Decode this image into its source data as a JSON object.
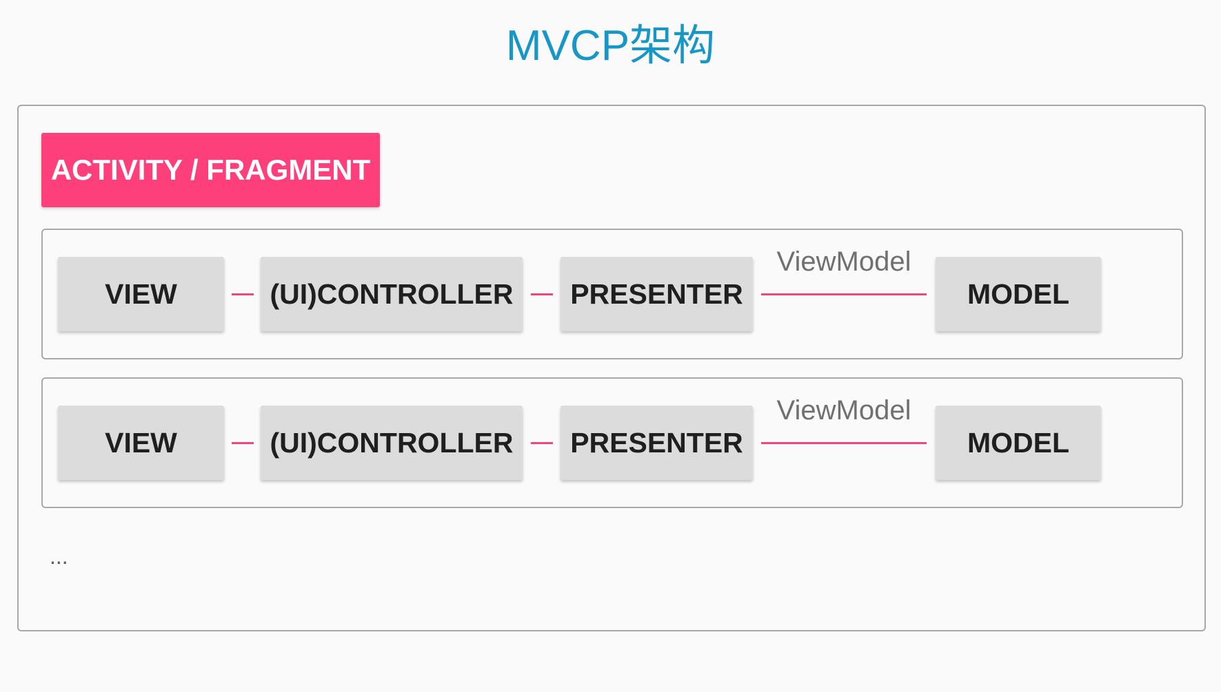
{
  "title": "MVCP架构",
  "container": {
    "tag_label": "ACTIVITY / FRAGMENT",
    "rows": [
      {
        "view": "VIEW",
        "controller": "(UI)CONTROLLER",
        "presenter": "PRESENTER",
        "link_label": "ViewModel",
        "model": "MODEL"
      },
      {
        "view": "VIEW",
        "controller": "(UI)CONTROLLER",
        "presenter": "PRESENTER",
        "link_label": "ViewModel",
        "model": "MODEL"
      }
    ],
    "more": "..."
  },
  "colors": {
    "title": "#1796c8",
    "tag_background": "#fd3f7c",
    "connector": "#f0457f",
    "box_background": "#dcdcdc",
    "border": "#a8a8a8"
  }
}
